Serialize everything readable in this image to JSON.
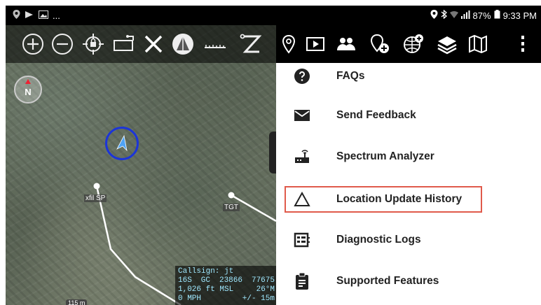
{
  "status_bar": {
    "left_dots": "...",
    "battery": "87%",
    "time": "9:33 PM"
  },
  "map": {
    "compass_label": "N",
    "waypoints": [
      {
        "label": "xfil SP"
      },
      {
        "label": "TGT"
      }
    ],
    "info": {
      "callsign": "Callsign: jt",
      "coord_zone": "16S",
      "coord_grid": "GC",
      "coord_easting": "23866",
      "coord_northing": "77675",
      "altitude": "1,026 ft MSL",
      "heading": "26°M",
      "speed": "0 MPH",
      "accuracy": "+/- 15m"
    },
    "scale_label": "115 m"
  },
  "toolbar_icons": [
    "zoom-in-icon",
    "zoom-out-icon",
    "locate-icon",
    "lock-icon",
    "range-bearing-icon",
    "close-icon",
    "3d-view-icon",
    "measure-icon"
  ],
  "menubar_icons": [
    "route-icon",
    "video-icon",
    "contacts-icon",
    "add-marker-icon",
    "map-overlay-icon",
    "layers-icon",
    "map-icon",
    "overflow-menu-icon"
  ],
  "menu": {
    "items": [
      {
        "label": "FAQs",
        "icon": "help-icon"
      },
      {
        "label": "Send Feedback",
        "icon": "mail-icon"
      },
      {
        "label": "Spectrum Analyzer",
        "icon": "router-icon"
      },
      {
        "label": "Location Update History",
        "icon": "triangle-icon"
      },
      {
        "label": "Diagnostic Logs",
        "icon": "logs-icon"
      },
      {
        "label": "Supported Features",
        "icon": "clipboard-icon"
      }
    ],
    "highlight_color": "#e05a4b"
  }
}
